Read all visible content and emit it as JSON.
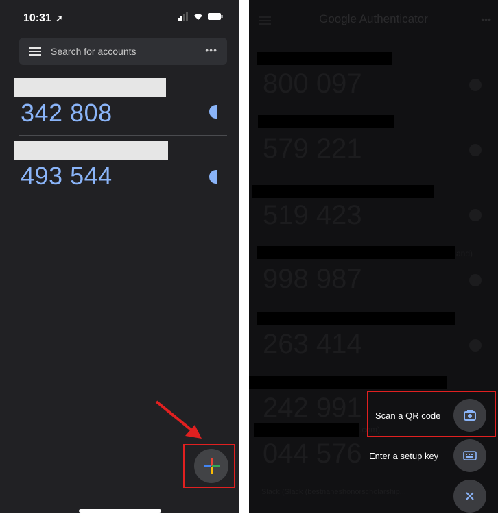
{
  "left": {
    "status_time": "10:31",
    "search_placeholder": "Search for accounts",
    "more_label": "•••",
    "accounts": [
      {
        "code": "342 808"
      },
      {
        "code": "493 544"
      }
    ]
  },
  "right": {
    "app_title": "Google Authenticator",
    "codes": [
      "800 097",
      "579 221",
      "519 423",
      "998 987",
      "263 414",
      "242 991",
      "044 576"
    ],
    "faint_fragments": [
      "and)",
      ".com)",
      "Slack (Slack (bestnaneshonorscholarship..."
    ],
    "scan_label": "Scan a QR code",
    "setup_label": "Enter a setup key"
  },
  "colors": {
    "code_blue": "#8ab4f8",
    "highlight_red": "#e02020"
  }
}
